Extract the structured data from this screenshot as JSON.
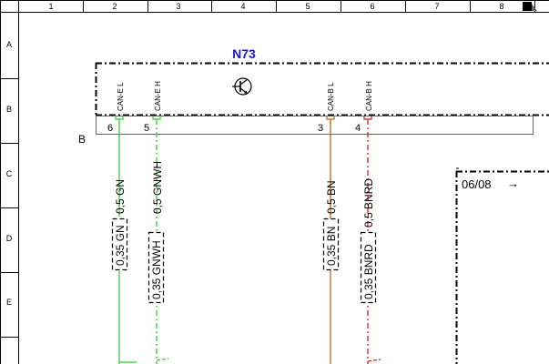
{
  "grid": {
    "columns": [
      "1",
      "2",
      "3",
      "4",
      "5",
      "6",
      "7",
      "8"
    ],
    "rows": [
      "A",
      "B",
      "C",
      "D",
      "E"
    ]
  },
  "component": {
    "name": "N73",
    "connector_label": "B",
    "pins": [
      {
        "signal": "CAN-E L",
        "number": "6"
      },
      {
        "signal": "CAN-E H",
        "number": "5"
      },
      {
        "signal": "CAN-B L",
        "number": "3"
      },
      {
        "signal": "CAN-B H",
        "number": "4"
      }
    ]
  },
  "wires": [
    {
      "color_hex": "#33cc33",
      "style": "solid",
      "label_a": "0,5 GN",
      "label_b": "0,35 GN"
    },
    {
      "color_hex": "#33cc33",
      "style": "dashed",
      "label_a": "0,5 GNWH",
      "label_b": "0,35 GNWH"
    },
    {
      "color_hex": "#b8651e",
      "style": "solid",
      "label_a": "0,5 BN",
      "label_b": "0,35 BN"
    },
    {
      "color_hex": "#cc2222",
      "style": "dashed",
      "label_a": "0,5 BNRD",
      "label_b": "0,35 BNRD"
    }
  ],
  "reference": {
    "text": "06/08",
    "arrow": "→"
  },
  "icons": {
    "transistor": "transistor-icon",
    "page_corner": "page-corner-icon"
  }
}
